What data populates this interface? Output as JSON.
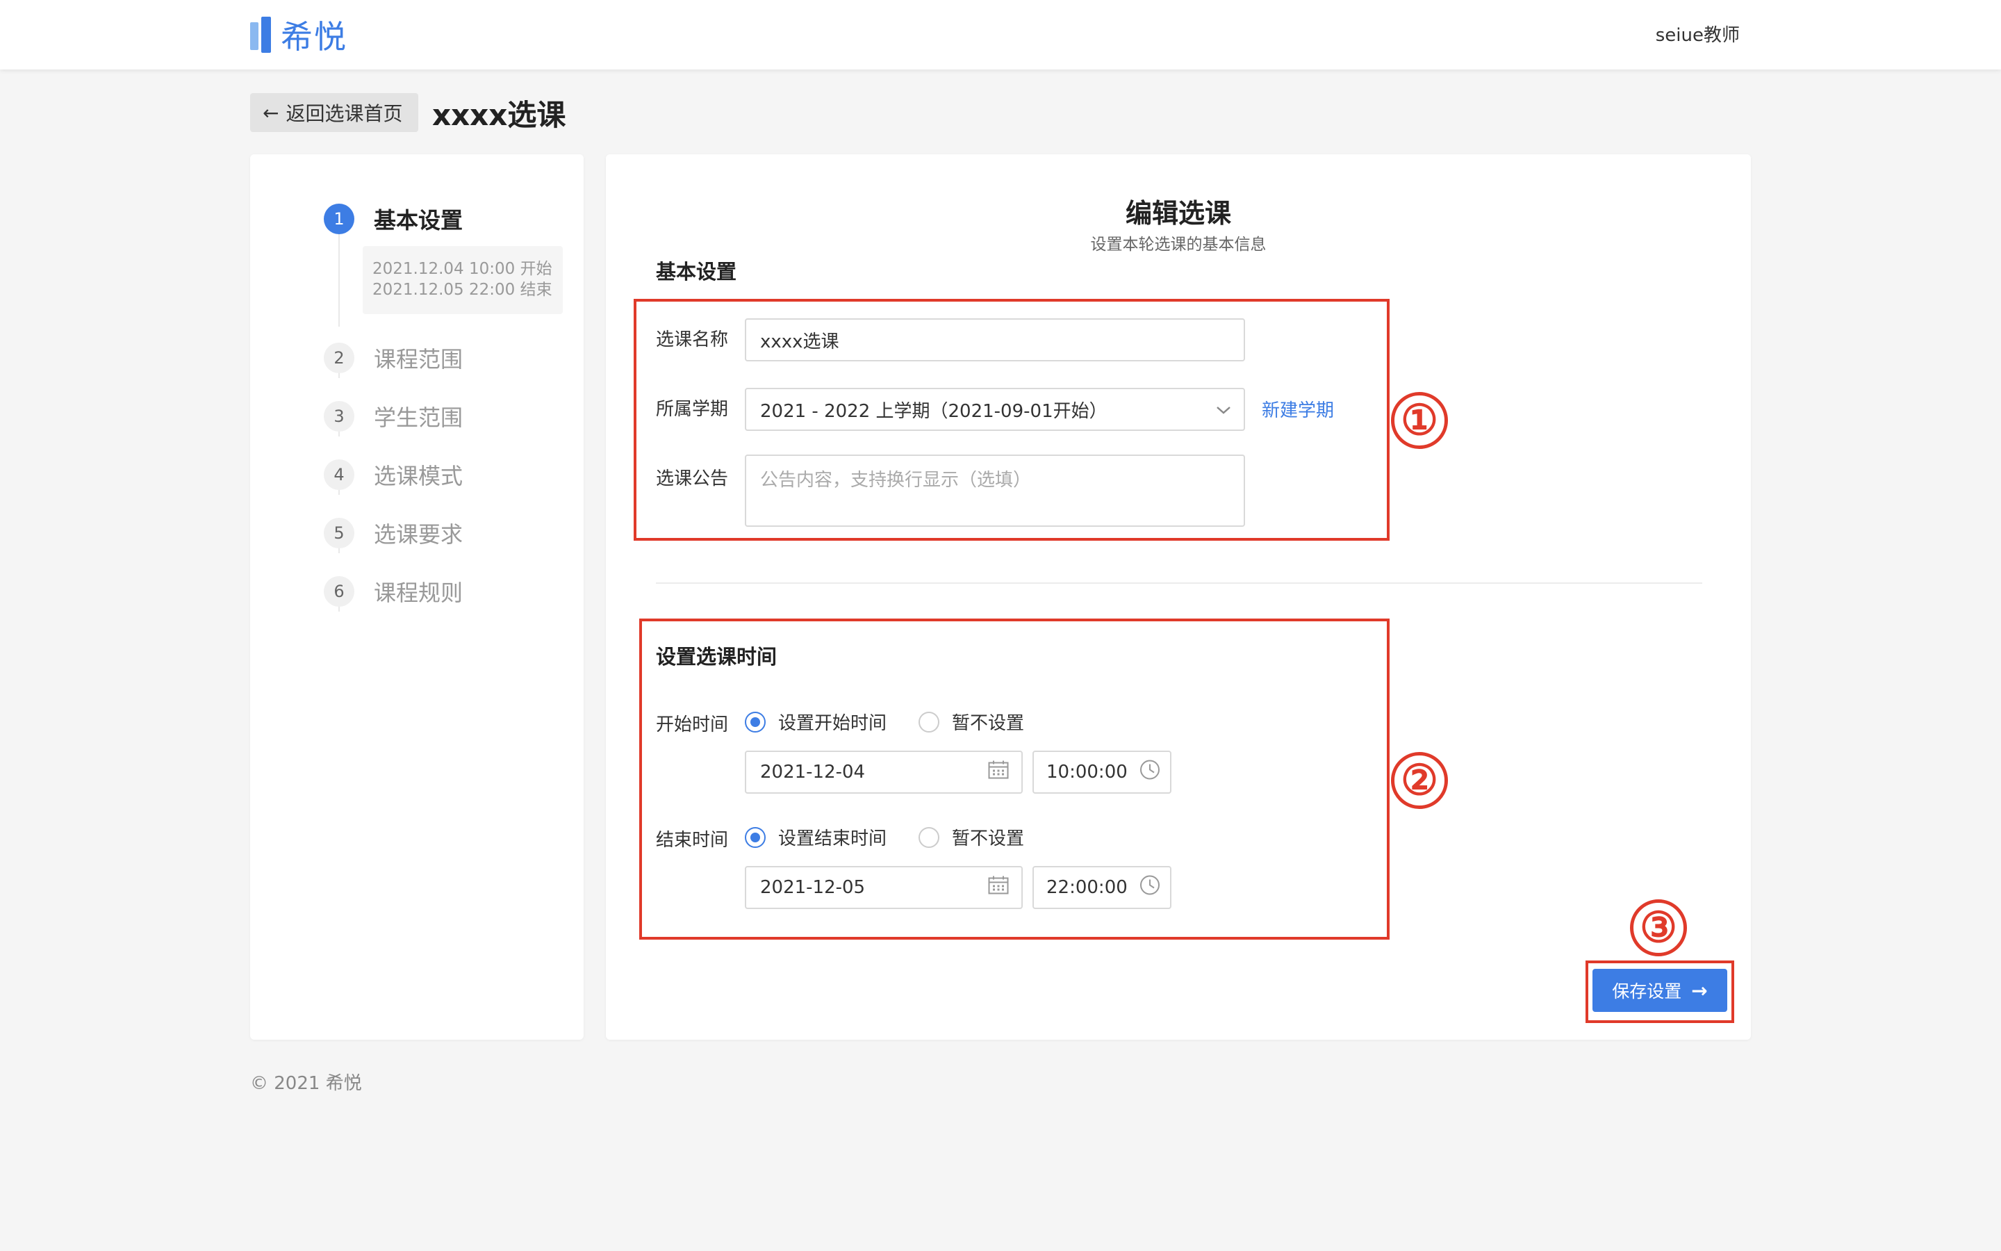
{
  "app": {
    "logo_text": "希悦",
    "user": "seiue教师",
    "brand_color": "#3d7de4"
  },
  "header": {
    "back_label": "返回选课首页",
    "back_icon": "arrow-left-icon",
    "title": "xxxx选课"
  },
  "steps": [
    {
      "num": "1",
      "label": "基本设置",
      "active": true
    },
    {
      "num": "2",
      "label": "课程范围",
      "active": false
    },
    {
      "num": "3",
      "label": "学生范围",
      "active": false
    },
    {
      "num": "4",
      "label": "选课模式",
      "active": false
    },
    {
      "num": "5",
      "label": "选课要求",
      "active": false
    },
    {
      "num": "6",
      "label": "课程规则",
      "active": false
    }
  ],
  "step_info": {
    "start": "2021.12.04 10:00 开始",
    "end": "2021.12.05 22:00 结束"
  },
  "form": {
    "title": "编辑选课",
    "subtitle": "设置本轮选课的基本信息",
    "basic_section": "基本设置",
    "name_label": "选课名称",
    "name_value": "xxxx选课",
    "term_label": "所属学期",
    "term_value": "2021 - 2022 上学期（2021-09-01开始）",
    "new_term_link": "新建学期",
    "notice_label": "选课公告",
    "notice_placeholder": "公告内容，支持换行显示（选填）",
    "time_section": "设置选课时间",
    "start_label": "开始时间",
    "start_option_set": "设置开始时间",
    "start_option_skip": "暂不设置",
    "start_date": "2021-12-04",
    "start_time": "10:00:00",
    "end_label": "结束时间",
    "end_option_set": "设置结束时间",
    "end_option_skip": "暂不设置",
    "end_date": "2021-12-05",
    "end_time": "22:00:00",
    "save_label": "保存设置"
  },
  "annotations": [
    "①",
    "②",
    "③"
  ],
  "annotation_color": "#e03a2a",
  "footer": "© 2021 希悦"
}
